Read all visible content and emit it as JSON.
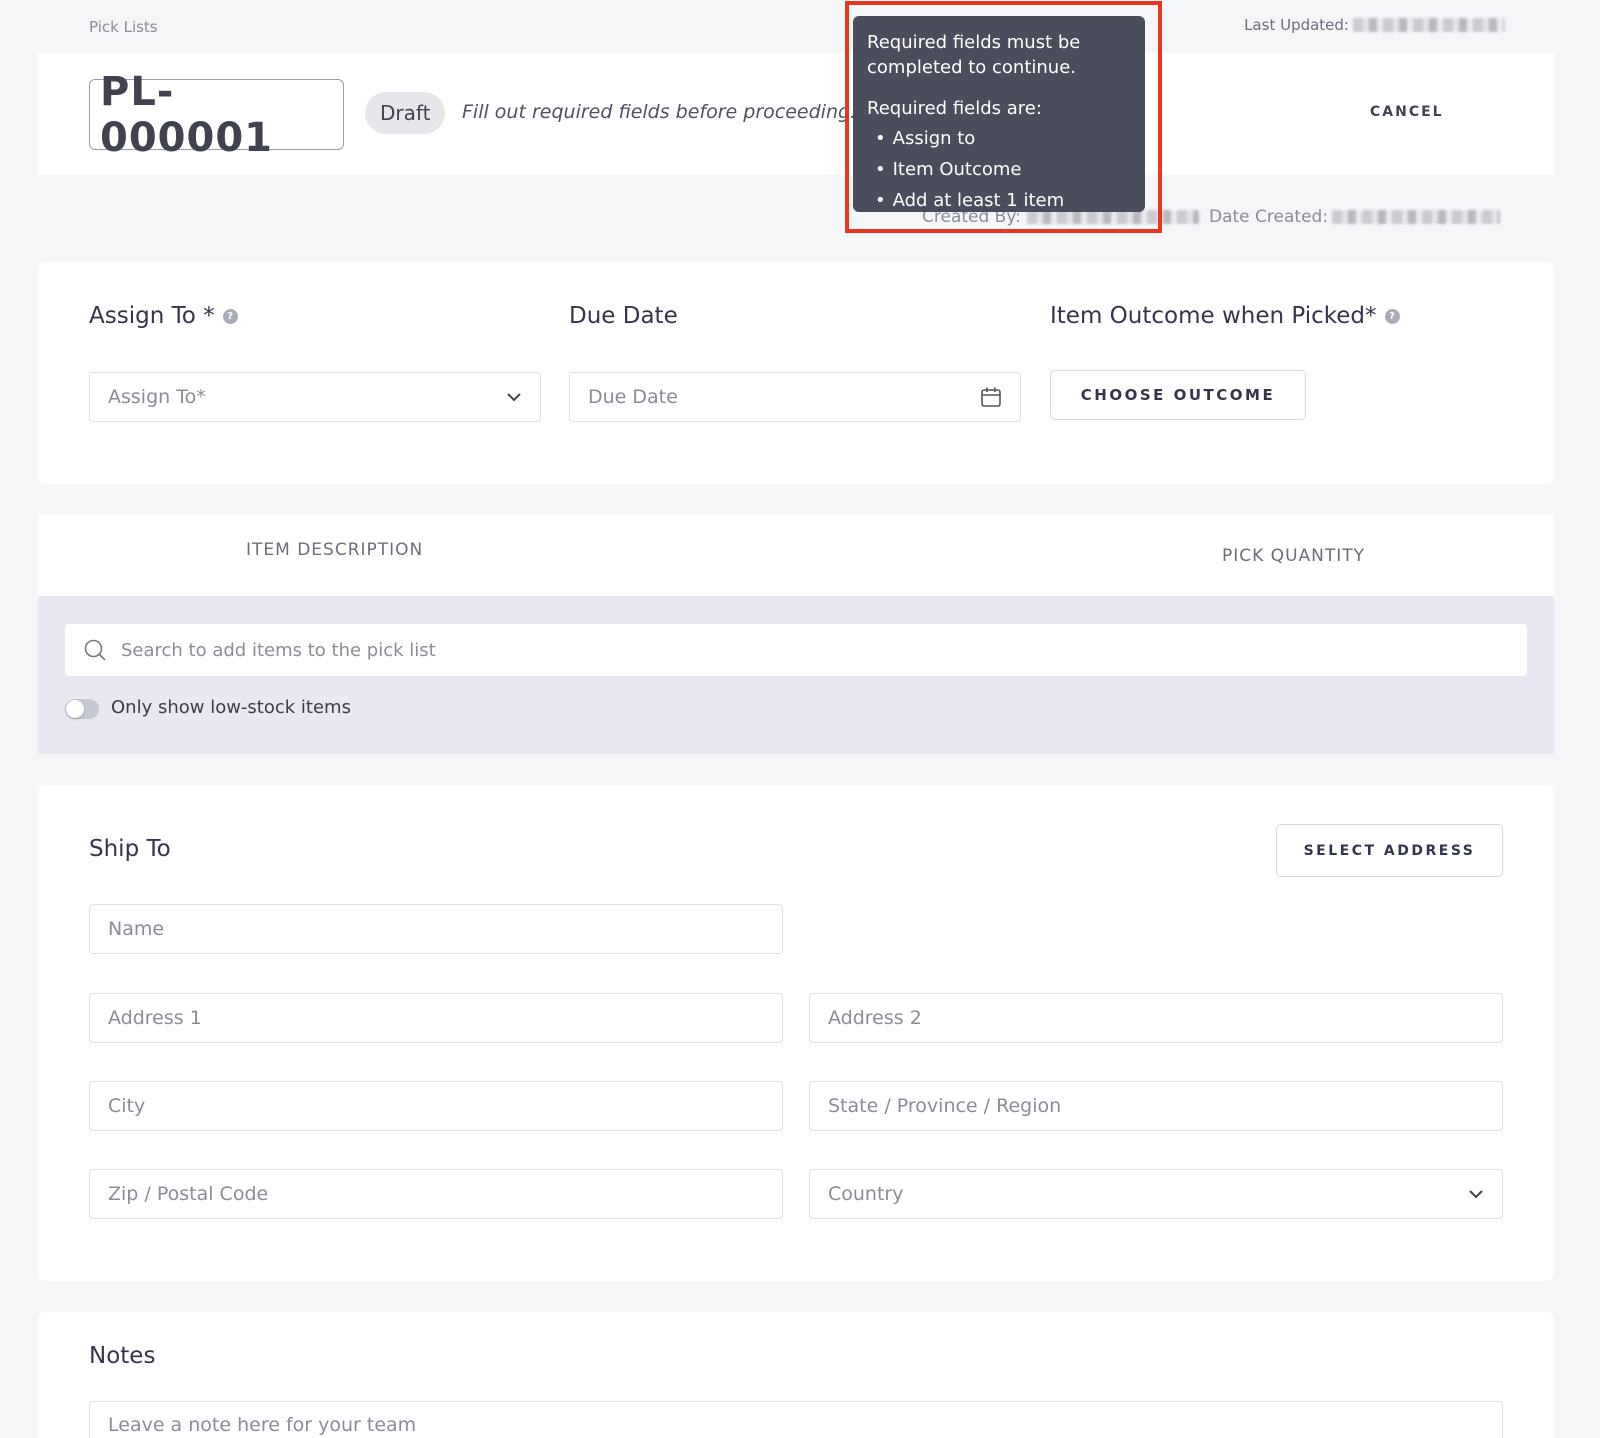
{
  "breadcrumb": "Pick Lists",
  "meta": {
    "last_updated_label": "Last Updated:",
    "created_by_label": "Created By:",
    "date_created_label": "Date Created:"
  },
  "header": {
    "pick_list_id": "PL-000001",
    "status_badge": "Draft",
    "fill_message": "Fill out required fields before proceeding.",
    "cancel_label": "CANCEL"
  },
  "tooltip": {
    "line1": "Required fields must be completed to continue.",
    "line2": "Required fields are:",
    "items": [
      "Assign to",
      "Item Outcome",
      "Add at least 1 item"
    ]
  },
  "assign": {
    "assign_to_label": "Assign To *",
    "assign_to_placeholder": "Assign To*",
    "due_date_label": "Due Date",
    "due_date_placeholder": "Due Date",
    "outcome_label": "Item Outcome when Picked*",
    "outcome_button": "CHOOSE OUTCOME"
  },
  "items": {
    "col_description": "ITEM DESCRIPTION",
    "col_quantity": "PICK QUANTITY",
    "search_placeholder": "Search to add items to the pick list",
    "low_stock_toggle_label": "Only show low-stock items",
    "low_stock_toggle_on": false
  },
  "ship_to": {
    "title": "Ship To",
    "select_address_button": "SELECT ADDRESS",
    "name_placeholder": "Name",
    "address1_placeholder": "Address 1",
    "address2_placeholder": "Address 2",
    "city_placeholder": "City",
    "state_placeholder": "State / Province / Region",
    "zip_placeholder": "Zip / Postal Code",
    "country_placeholder": "Country"
  },
  "notes": {
    "title": "Notes",
    "placeholder": "Leave a note here for your team"
  },
  "colors": {
    "highlight_border": "#e8361f",
    "tooltip_bg": "#4a4d5c",
    "page_bg": "#f5f6f8",
    "items_body_bg": "#e7e8f1"
  }
}
